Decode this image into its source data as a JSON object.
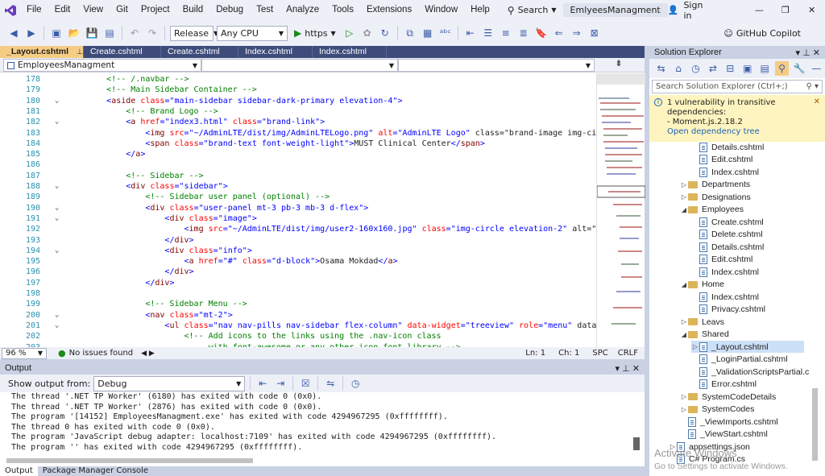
{
  "menu": [
    "File",
    "Edit",
    "View",
    "Git",
    "Project",
    "Build",
    "Debug",
    "Test",
    "Analyze",
    "Tools",
    "Extensions",
    "Window",
    "Help"
  ],
  "search_label": "Search",
  "solution_name": "EmlyeesManagment",
  "signin": "Sign in",
  "toolbar": {
    "config": "Release",
    "platform": "Any CPU",
    "run_label": "https",
    "copilot": "GitHub Copilot"
  },
  "tabs": [
    "_Layout.cshtml",
    "Create.cshtml",
    "Create.cshtml",
    "Index.cshtml",
    "Index.cshtml"
  ],
  "navbar": {
    "project": "EmployeesManagment"
  },
  "code_lines": [
    {
      "n": "178",
      "t": "        <!-- /.navbar -->",
      "c": "cm"
    },
    {
      "n": "179",
      "t": "        <!-- Main Sidebar Container -->",
      "c": "cm"
    },
    {
      "n": "180",
      "t": "        <aside class=\"main-sidebar sidebar-dark-primary elevation-4\">",
      "c": ""
    },
    {
      "n": "181",
      "t": "            <!-- Brand Logo -->",
      "c": "cm"
    },
    {
      "n": "182",
      "t": "            <a href=\"index3.html\" class=\"brand-link\">",
      "c": ""
    },
    {
      "n": "183",
      "t": "                <img src=\"~/AdminLTE/dist/img/AdminLTELogo.png\" alt=\"AdminLTE Logo\" class=\"brand-image img-cir",
      "c": ""
    },
    {
      "n": "184",
      "t": "                <span class=\"brand-text font-weight-light\">MUST Clinical Center</span>",
      "c": ""
    },
    {
      "n": "185",
      "t": "            </a>",
      "c": ""
    },
    {
      "n": "186",
      "t": "",
      "c": ""
    },
    {
      "n": "187",
      "t": "            <!-- Sidebar -->",
      "c": "cm"
    },
    {
      "n": "188",
      "t": "            <div class=\"sidebar\">",
      "c": ""
    },
    {
      "n": "189",
      "t": "                <!-- Sidebar user panel (optional) -->",
      "c": "cm"
    },
    {
      "n": "190",
      "t": "                <div class=\"user-panel mt-3 pb-3 mb-3 d-flex\">",
      "c": ""
    },
    {
      "n": "191",
      "t": "                    <div class=\"image\">",
      "c": ""
    },
    {
      "n": "192",
      "t": "                        <img src=\"~/AdminLTE/dist/img/user2-160x160.jpg\" class=\"img-circle elevation-2\" alt=\"U",
      "c": ""
    },
    {
      "n": "193",
      "t": "                    </div>",
      "c": ""
    },
    {
      "n": "194",
      "t": "                    <div class=\"info\">",
      "c": ""
    },
    {
      "n": "195",
      "t": "                        <a href=\"#\" class=\"d-block\">Osama Mokdad</a>",
      "c": ""
    },
    {
      "n": "196",
      "t": "                    </div>",
      "c": ""
    },
    {
      "n": "197",
      "t": "                </div>",
      "c": ""
    },
    {
      "n": "198",
      "t": "",
      "c": ""
    },
    {
      "n": "199",
      "t": "                <!-- Sidebar Menu -->",
      "c": "cm"
    },
    {
      "n": "200",
      "t": "                <nav class=\"mt-2\">",
      "c": ""
    },
    {
      "n": "201",
      "t": "                    <ul class=\"nav nav-pills nav-sidebar flex-column\" data-widget=\"treeview\" role=\"menu\" data-",
      "c": ""
    },
    {
      "n": "202",
      "t": "                        <!-- Add icons to the links using the .nav-icon class",
      "c": "cm"
    },
    {
      "n": "203",
      "t": "                             with font-awesome or any other icon font library -->",
      "c": "cm"
    }
  ],
  "status": {
    "zoom": "96 %",
    "issues": "No issues found",
    "line": "Ln: 1",
    "col": "Ch: 1",
    "mode": "SPC",
    "eol": "CRLF"
  },
  "output": {
    "title": "Output",
    "show_from_label": "Show output from:",
    "source": "Debug",
    "lines": [
      "The thread '.NET TP Worker' (6180) has exited with code 0 (0x0).",
      "The thread '.NET TP Worker' (2876) has exited with code 0 (0x0).",
      "The program '[14152] EmployeesManagment.exe' has exited with code 4294967295 (0xffffffff).",
      "The thread 0 has exited with code 0 (0x0).",
      "The program 'JavaScript debug adapter: localhost:7109' has exited with code 4294967295 (0xffffffff).",
      "The program '' has exited with code 4294967295 (0xffffffff)."
    ],
    "tabs": [
      "Output",
      "Package Manager Console"
    ]
  },
  "solution_explorer": {
    "title": "Solution Explorer",
    "search_placeholder": "Search Solution Explorer (Ctrl+;)",
    "vuln_title": "1 vulnerability in transitive dependencies:",
    "vuln_item": "- Moment.js.2.18.2",
    "vuln_link": "Open dependency tree",
    "tree": [
      {
        "label": "Details.cshtml",
        "kind": "file",
        "indent": 3,
        "exp": ""
      },
      {
        "label": "Edit.cshtml",
        "kind": "file",
        "indent": 3,
        "exp": ""
      },
      {
        "label": "Index.cshtml",
        "kind": "file",
        "indent": 3,
        "exp": ""
      },
      {
        "label": "Departments",
        "kind": "folder",
        "indent": 2,
        "exp": "▷"
      },
      {
        "label": "Designations",
        "kind": "folder",
        "indent": 2,
        "exp": "▷"
      },
      {
        "label": "Employees",
        "kind": "folder",
        "indent": 2,
        "exp": "◢"
      },
      {
        "label": "Create.cshtml",
        "kind": "file",
        "indent": 3,
        "exp": ""
      },
      {
        "label": "Delete.cshtml",
        "kind": "file",
        "indent": 3,
        "exp": ""
      },
      {
        "label": "Details.cshtml",
        "kind": "file",
        "indent": 3,
        "exp": ""
      },
      {
        "label": "Edit.cshtml",
        "kind": "file",
        "indent": 3,
        "exp": ""
      },
      {
        "label": "Index.cshtml",
        "kind": "file",
        "indent": 3,
        "exp": ""
      },
      {
        "label": "Home",
        "kind": "folder",
        "indent": 2,
        "exp": "◢"
      },
      {
        "label": "Index.cshtml",
        "kind": "file",
        "indent": 3,
        "exp": ""
      },
      {
        "label": "Privacy.cshtml",
        "kind": "file",
        "indent": 3,
        "exp": ""
      },
      {
        "label": "Leavs",
        "kind": "folder",
        "indent": 2,
        "exp": "▷"
      },
      {
        "label": "Shared",
        "kind": "folder",
        "indent": 2,
        "exp": "◢"
      },
      {
        "label": "_Layout.cshtml",
        "kind": "file",
        "indent": 3,
        "exp": "▷",
        "selected": true
      },
      {
        "label": "_LoginPartial.cshtml",
        "kind": "file",
        "indent": 3,
        "exp": ""
      },
      {
        "label": "_ValidationScriptsPartial.c",
        "kind": "file",
        "indent": 3,
        "exp": ""
      },
      {
        "label": "Error.cshtml",
        "kind": "file",
        "indent": 3,
        "exp": ""
      },
      {
        "label": "SystemCodeDetails",
        "kind": "folder",
        "indent": 2,
        "exp": "▷"
      },
      {
        "label": "SystemCodes",
        "kind": "folder",
        "indent": 2,
        "exp": "▷"
      },
      {
        "label": "_ViewImports.cshtml",
        "kind": "file",
        "indent": 2,
        "exp": ""
      },
      {
        "label": "_ViewStart.cshtml",
        "kind": "file",
        "indent": 2,
        "exp": ""
      },
      {
        "label": "appsettings.json",
        "kind": "file",
        "indent": 1,
        "exp": "▷"
      },
      {
        "label": "C# Program.cs",
        "kind": "file",
        "indent": 1,
        "exp": ""
      }
    ]
  },
  "watermark": {
    "line1": "Activate Windows",
    "line2": "Go to Settings to activate Windows."
  }
}
